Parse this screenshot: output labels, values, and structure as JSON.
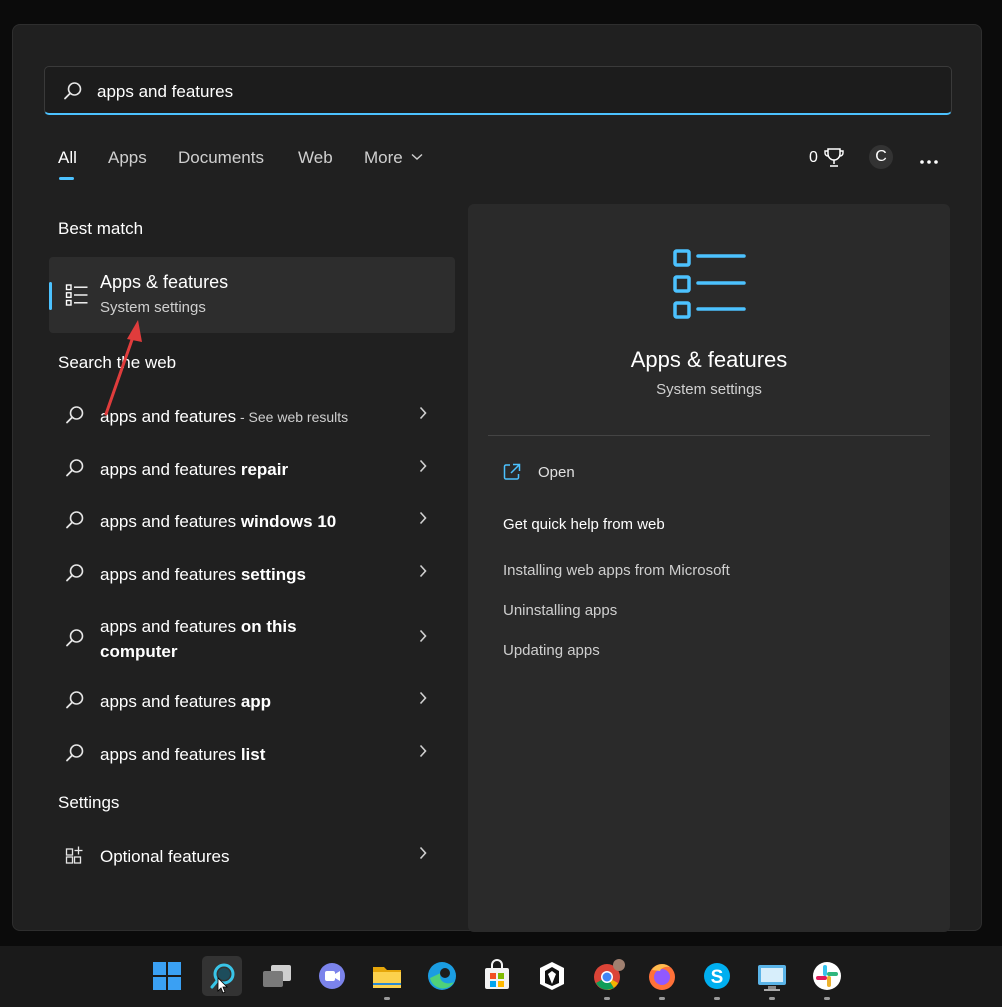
{
  "search": {
    "value": "apps and features"
  },
  "tabs": [
    {
      "label": "All"
    },
    {
      "label": "Apps"
    },
    {
      "label": "Documents"
    },
    {
      "label": "Web"
    },
    {
      "label": "More"
    }
  ],
  "toolbar": {
    "rewards_count": "0",
    "user_initial": "C"
  },
  "left": {
    "best_match_title": "Best match",
    "best_match": {
      "title": "Apps & features",
      "subtitle": "System settings"
    },
    "search_web_title": "Search the web",
    "web_results": [
      {
        "prefix": "apps and features",
        "bold": "",
        "suffix": " - See web results"
      },
      {
        "prefix": "apps and features ",
        "bold": "repair",
        "suffix": ""
      },
      {
        "prefix": "apps and features ",
        "bold": "windows 10",
        "suffix": ""
      },
      {
        "prefix": "apps and features ",
        "bold": "settings",
        "suffix": ""
      },
      {
        "prefix": "apps and features ",
        "bold": "on this",
        "line2": "computer",
        "suffix": ""
      },
      {
        "prefix": "apps and features ",
        "bold": "app",
        "suffix": ""
      },
      {
        "prefix": "apps and features ",
        "bold": "list",
        "suffix": ""
      }
    ],
    "settings_title": "Settings",
    "settings_item": "Optional features"
  },
  "right": {
    "title": "Apps & features",
    "subtitle": "System settings",
    "open_label": "Open",
    "help_title": "Get quick help from web",
    "links": [
      "Installing web apps from Microsoft",
      "Uninstalling apps",
      "Updating apps"
    ]
  },
  "colors": {
    "accent": "#4cc2ff",
    "annotation_arrow": "#e03c3c"
  },
  "taskbar": {
    "icons": [
      "windows-start-icon",
      "search-icon",
      "task-view-icon",
      "teams-chat-icon",
      "file-explorer-icon",
      "edge-icon",
      "microsoft-store-icon",
      "app-icon",
      "chrome-icon",
      "firefox-icon",
      "skype-icon",
      "remote-desktop-icon",
      "slack-icon"
    ]
  }
}
